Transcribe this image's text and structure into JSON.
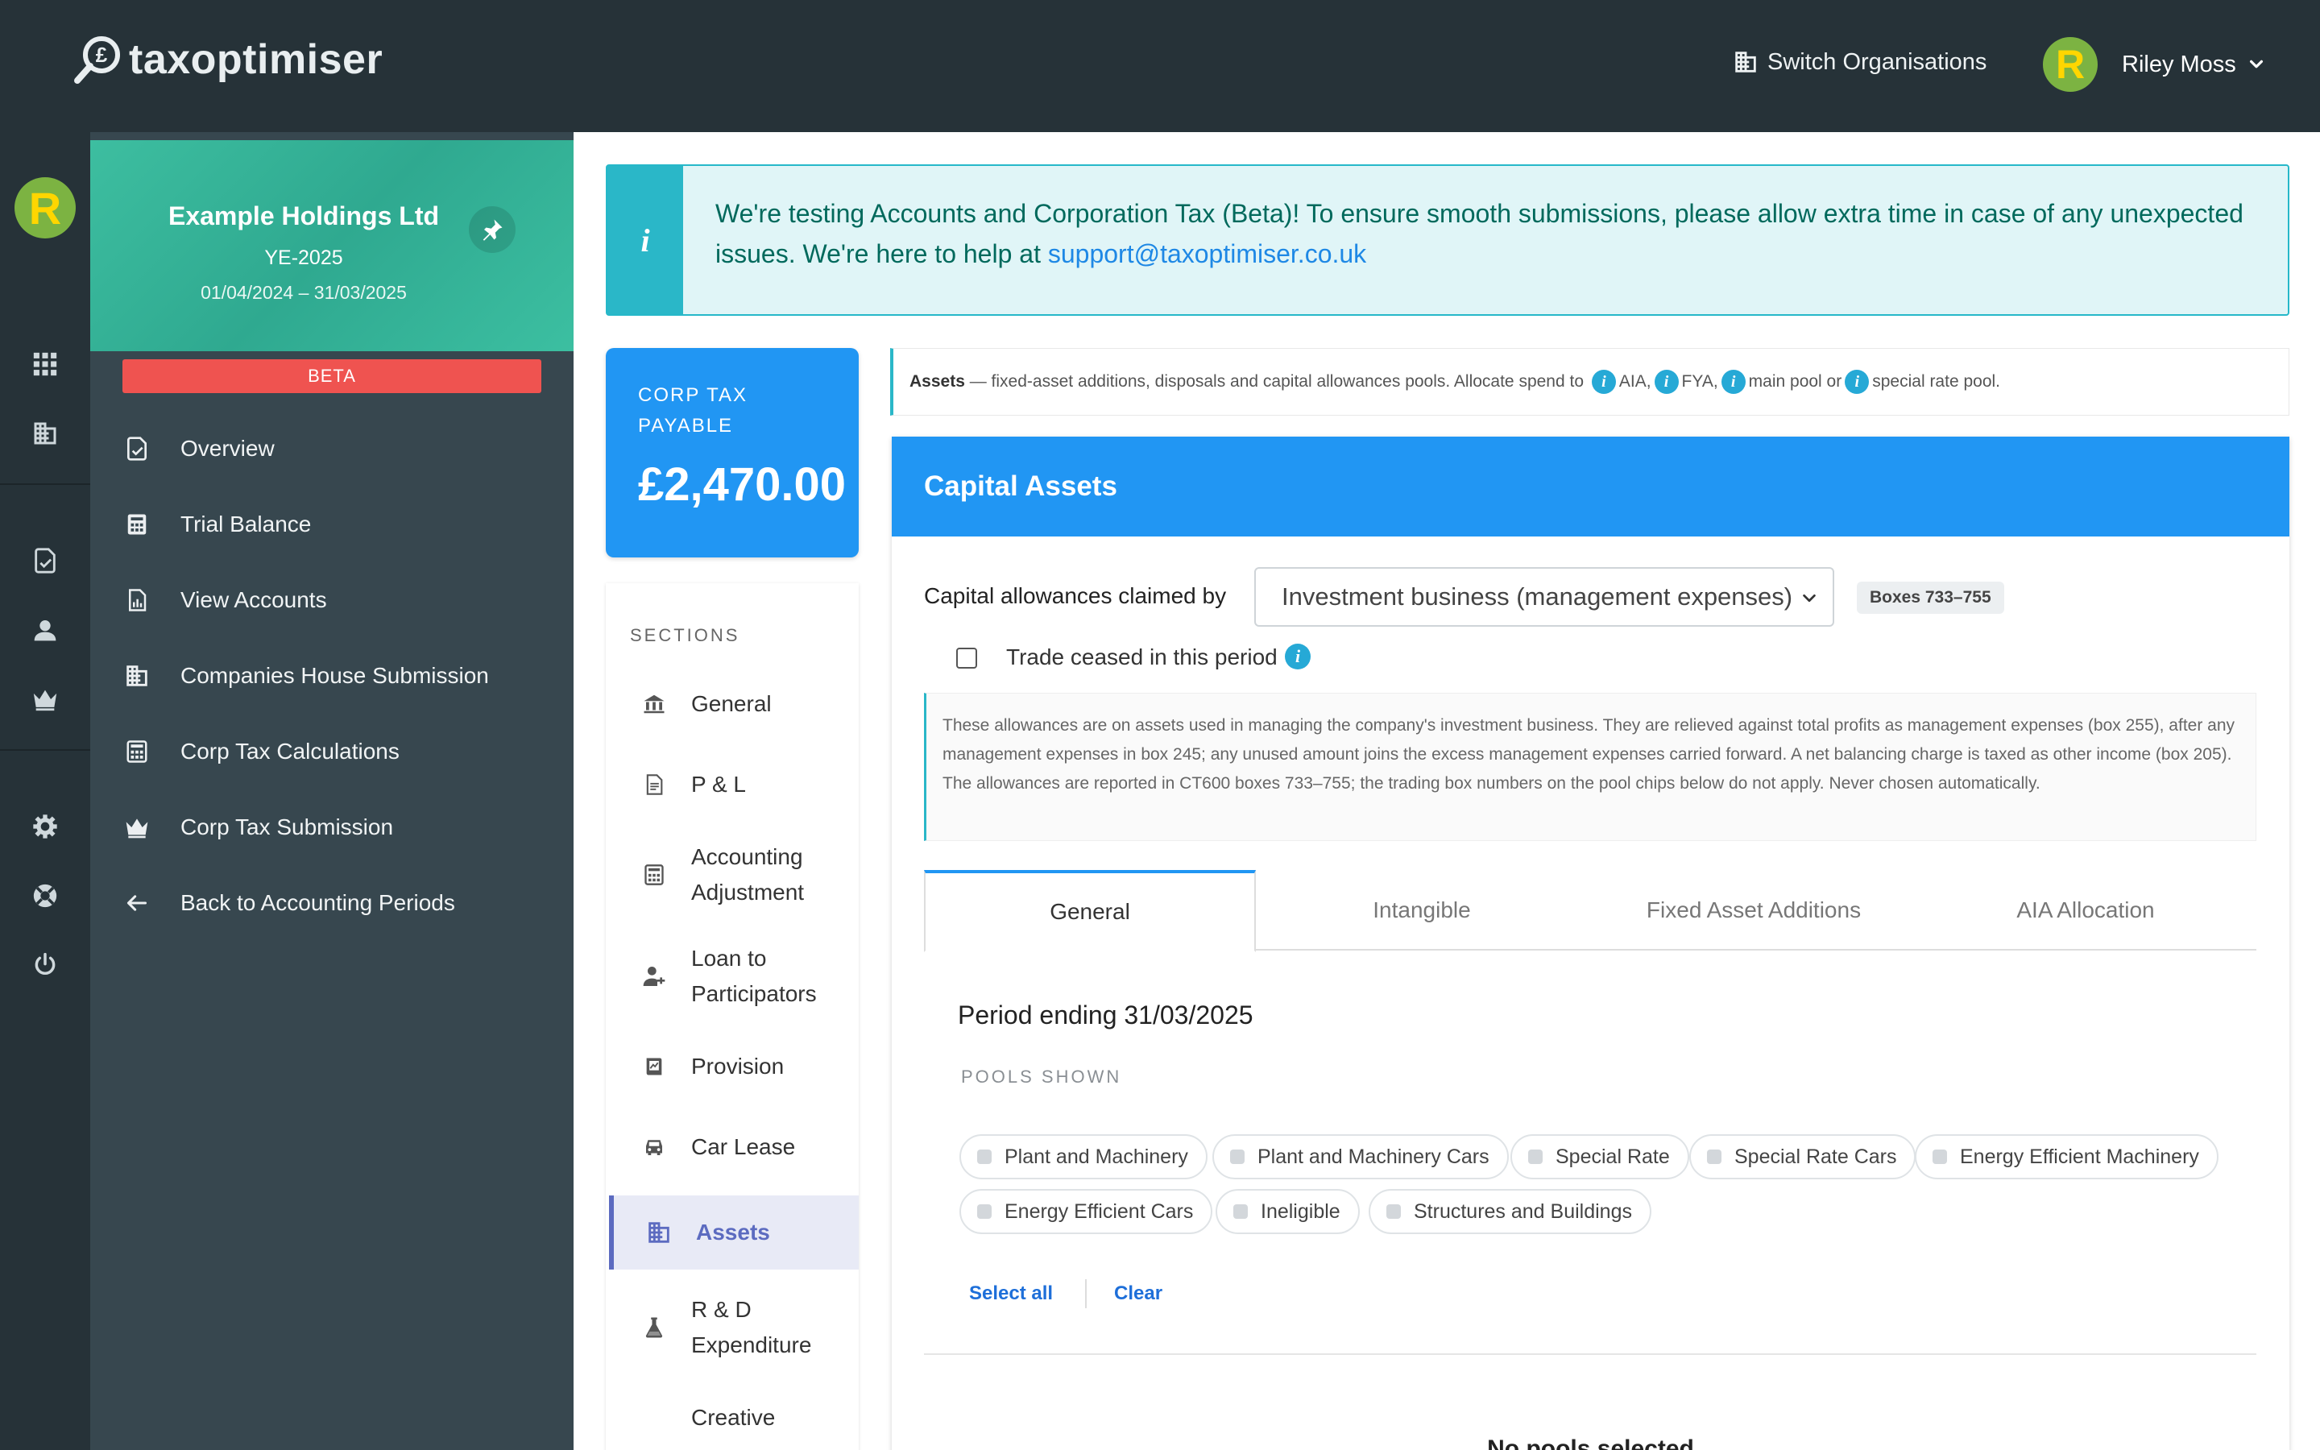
{
  "app": {
    "logo_text": "taxoptimiser",
    "switch_org_label": "Switch Organisations",
    "user_name": "Riley Moss",
    "avatar_letter": "R"
  },
  "company": {
    "name": "Example Holdings Ltd",
    "year_end": "YE-2025",
    "dates": "01/04/2024 – 31/03/2025",
    "badge": "BETA"
  },
  "nav": [
    {
      "label": "Overview",
      "icon": "overview-icon"
    },
    {
      "label": "Trial Balance",
      "icon": "trial-balance-icon"
    },
    {
      "label": "View Accounts",
      "icon": "view-accounts-icon"
    },
    {
      "label": "Companies House Submission",
      "icon": "companies-house-icon"
    },
    {
      "label": "Corp Tax Calculations",
      "icon": "calculator-icon"
    },
    {
      "label": "Corp Tax Submission",
      "icon": "crown-icon"
    },
    {
      "label": "Back to Accounting Periods",
      "icon": "back-arrow-icon"
    }
  ],
  "alert": {
    "text": "We're testing Accounts and Corporation Tax (Beta)! To ensure smooth submissions, please allow extra time in case of any unexpected issues. We're here to help at ",
    "email": "support@taxoptimiser.co.uk"
  },
  "tax": {
    "label": "CORP TAX PAYABLE",
    "value": "£2,470.00"
  },
  "sections": {
    "heading": "SECTIONS",
    "items": [
      {
        "label": "General"
      },
      {
        "label": "P & L"
      },
      {
        "label": "Accounting Adjustment"
      },
      {
        "label": "Loan to Participators"
      },
      {
        "label": "Provision"
      },
      {
        "label": "Car Lease"
      },
      {
        "label": "Assets"
      },
      {
        "label": "R & D Expenditure"
      },
      {
        "label": "Creative"
      }
    ]
  },
  "note": {
    "title": "Assets",
    "text": " — fixed-asset additions, disposals and capital allowances pools. Allocate spend to ",
    "aia": "AIA,",
    "fya": "FYA,",
    "main": "main pool or",
    "special": "special rate pool."
  },
  "capital": {
    "title": "Capital Assets",
    "claim_label": "Capital allowances claimed by",
    "claim_value": "Investment business (management expenses)",
    "boxes": "Boxes 733–755",
    "ceased_label": "Trade ceased in this period",
    "ceased_checked": false,
    "explanation": "These allowances are on assets used in managing the company's investment business. They are relieved against total profits as management expenses (box 255), after any management expenses in box 245; any unused amount joins the excess management expenses carried forward. A net balancing charge is taxed as other income (box 205). The allowances are reported in CT600 boxes 733–755; the trading box numbers on the pool chips below do not apply. Never chosen automatically.",
    "tabs": [
      "General",
      "Intangible",
      "Fixed Asset Additions",
      "AIA Allocation"
    ],
    "active_tab": "General",
    "period": "Period ending 31/03/2025",
    "pools_heading": "POOLS SHOWN",
    "pools": [
      "Plant and Machinery",
      "Plant and Machinery Cars",
      "Special Rate",
      "Special Rate Cars",
      "Energy Efficient Machinery",
      "Energy Efficient Cars",
      "Ineligible",
      "Structures and Buildings"
    ],
    "select_all": "Select all",
    "clear": "Clear",
    "empty": "No pools selected"
  },
  "colors": {
    "topbar": "#263238",
    "sidebar": "#37474f",
    "accent": "#2196f3",
    "teal": "#3dbea0",
    "beta": "#ef5350",
    "active_section": "#5c6bc0"
  }
}
